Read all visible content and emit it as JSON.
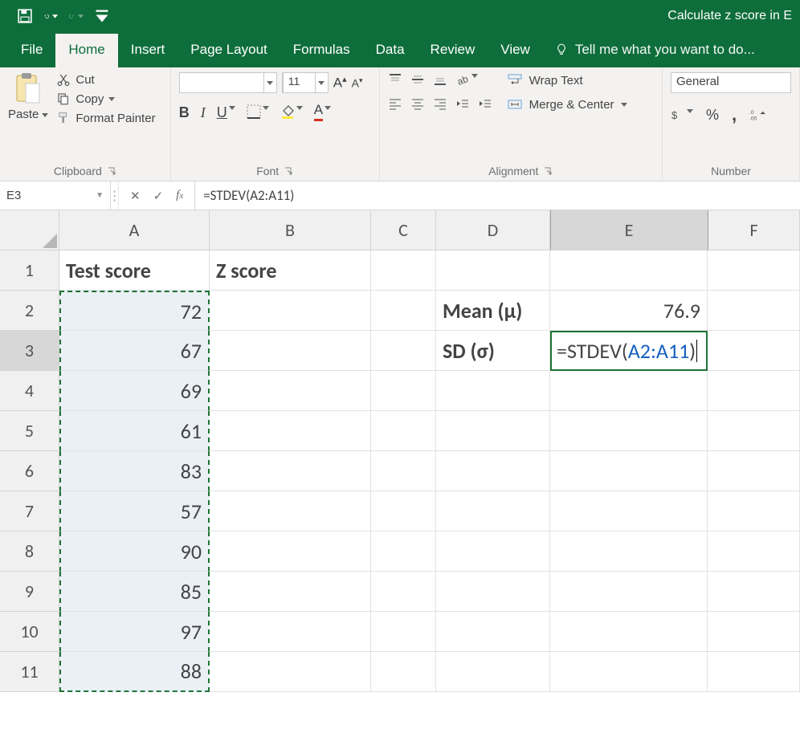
{
  "title": "Calculate z score in E",
  "tabs": {
    "file": "File",
    "home": "Home",
    "insert": "Insert",
    "page_layout": "Page Layout",
    "formulas": "Formulas",
    "data": "Data",
    "review": "Review",
    "view": "View",
    "tell_me": "Tell me what you want to do..."
  },
  "ribbon": {
    "clipboard": {
      "paste": "Paste",
      "cut": "Cut",
      "copy": "Copy",
      "format_painter": "Format Painter",
      "label": "Clipboard"
    },
    "font": {
      "name": "",
      "size": "11",
      "label": "Font"
    },
    "alignment": {
      "wrap_text": "Wrap Text",
      "merge_center": "Merge & Center",
      "label": "Alignment"
    },
    "number": {
      "format": "General",
      "percent": "%",
      "comma": ",",
      "decimal_inc": ".0←",
      "decimal_dec": ".00",
      "label": "Number"
    }
  },
  "formula_bar": {
    "name_box": "E3",
    "formula": "=STDEV(A2:A11)"
  },
  "columns": [
    "A",
    "B",
    "C",
    "D",
    "E",
    "F"
  ],
  "rows": [
    "1",
    "2",
    "3",
    "4",
    "5",
    "6",
    "7",
    "8",
    "9",
    "10",
    "11"
  ],
  "cells": {
    "A1": "Test score",
    "B1": "Z score",
    "D2": "Mean (μ)",
    "E2": "76.9",
    "D3": "SD (σ)",
    "E3_prefix": "=STDEV(",
    "E3_ref": "A2:A11",
    "E3_suffix": ")",
    "A2": "72",
    "A3": "67",
    "A4": "69",
    "A5": "61",
    "A6": "83",
    "A7": "57",
    "A8": "90",
    "A9": "85",
    "A10": "97",
    "A11": "88"
  }
}
